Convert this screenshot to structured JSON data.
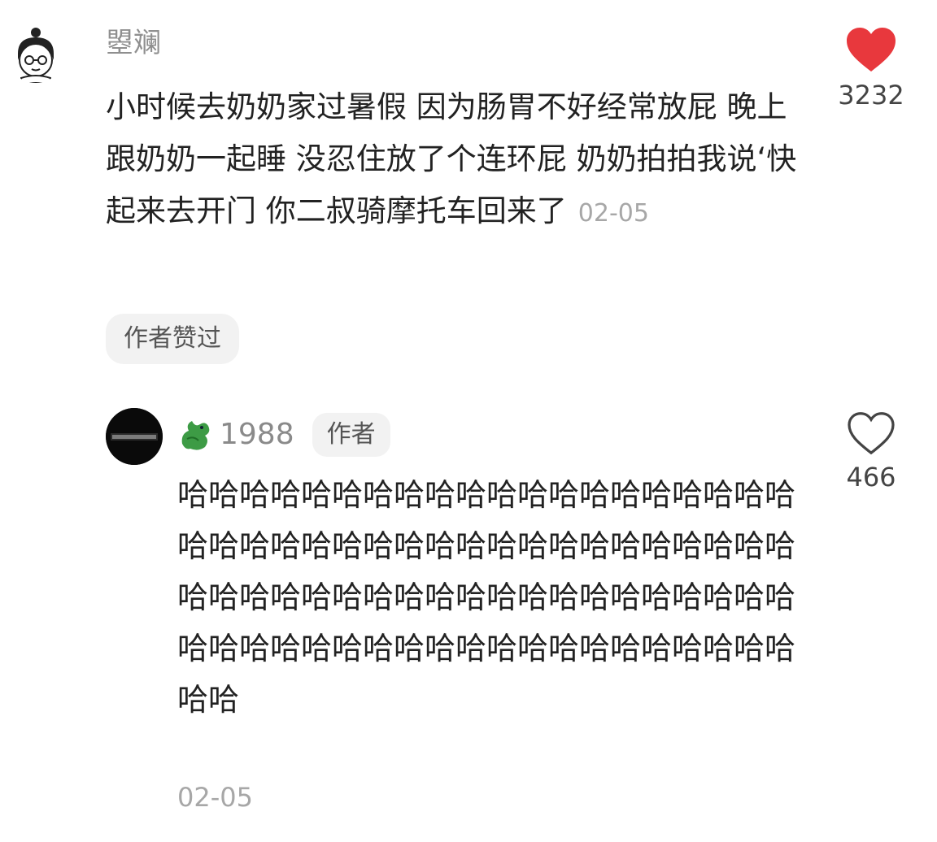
{
  "comments": [
    {
      "username": "曌斓",
      "text": "小时候去奶奶家过暑假 因为肠胃不好经常放屁 晚上跟奶奶一起睡 没忍住放了个连环屁 奶奶拍拍我说‘快起来去开门 你二叔骑摩托车回来了",
      "date": "02-05",
      "badge": "作者赞过",
      "likes": "3232",
      "liked": true,
      "heart_color": "#e8383d"
    },
    {
      "username": "1988",
      "author_tag": "作者",
      "text": "哈哈哈哈哈哈哈哈哈哈哈哈哈哈哈哈哈哈哈哈哈哈哈哈哈哈哈哈哈哈哈哈哈哈哈哈哈哈哈哈哈哈哈哈哈哈哈哈哈哈哈哈哈哈哈哈哈哈哈哈哈哈哈哈哈哈哈哈哈哈哈哈哈哈哈哈哈哈哈哈哈哈",
      "date": "02-05",
      "likes": "466",
      "liked": false,
      "name_icon": "green-dragon-icon"
    }
  ]
}
